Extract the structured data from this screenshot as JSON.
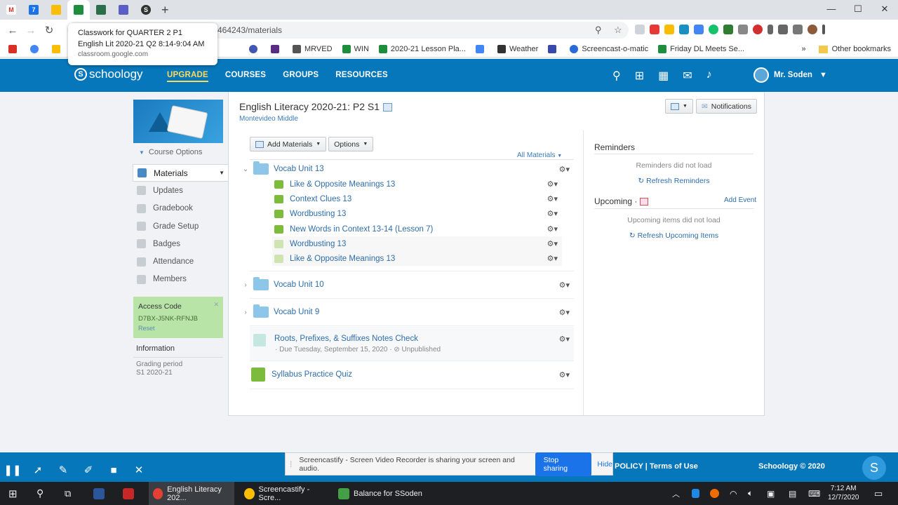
{
  "browser": {
    "tooltip": {
      "title": "Classwork for QUARTER 2 P1 English Lit 2020-21 Q2 8:14-9:04 AM",
      "url": "classroom.google.com"
    },
    "address_url": "464243/materials",
    "bookmarks": [
      {
        "label": "MRVED",
        "color": "#555555"
      },
      {
        "label": "WIN",
        "color": "#1e8e3e"
      },
      {
        "label": "2020-21 Lesson Pla...",
        "color": "#1e8e3e"
      },
      {
        "label": "Weather",
        "color": "#333333"
      },
      {
        "label": "Screencast-o-matic",
        "color": "#2a6ad6"
      },
      {
        "label": "Friday DL Meets Se...",
        "color": "#1e8e3e"
      }
    ],
    "other_bookmarks": "Other bookmarks",
    "more": "»"
  },
  "header": {
    "logo": "schoology",
    "nav": [
      "UPGRADE",
      "COURSES",
      "GROUPS",
      "RESOURCES"
    ],
    "user": "Mr. Soden"
  },
  "sidebar": {
    "course_options": "Course Options",
    "items": [
      {
        "label": "Materials"
      },
      {
        "label": "Updates"
      },
      {
        "label": "Gradebook"
      },
      {
        "label": "Grade Setup"
      },
      {
        "label": "Badges"
      },
      {
        "label": "Attendance"
      },
      {
        "label": "Members"
      }
    ],
    "access": {
      "title": "Access Code",
      "code": "D7BX-J5NK-RFNJB",
      "reset": "Reset"
    },
    "info_title": "Information",
    "grading_label": "Grading period",
    "grading_value": "S1 2020-21"
  },
  "course": {
    "title": "English Literacy 2020-21: P2 S1",
    "school": "Montevideo Middle",
    "notifications": "Notifications"
  },
  "materials": {
    "add": "Add Materials",
    "options": "Options",
    "filter": "All Materials",
    "folder1": "Vocab Unit 13",
    "children": [
      "Like & Opposite Meanings 13",
      "Context Clues 13",
      "Wordbusting 13",
      "New Words in Context 13-14 (Lesson 7)",
      "Wordbusting 13",
      "Like & Opposite Meanings 13"
    ],
    "folder2": "Vocab Unit 10",
    "folder3": "Vocab Unit 9",
    "assignment": {
      "title": "Roots, Prefixes, & Suffixes Notes Check",
      "due": "· Due Tuesday, September 15, 2020 · ⊘ Unpublished"
    },
    "quiz": "Syllabus Practice Quiz"
  },
  "right": {
    "reminders": "Reminders",
    "reminders_msg": "Reminders did not load",
    "refresh_reminders": "Refresh Reminders",
    "upcoming": "Upcoming ·",
    "add_event": "Add Event",
    "upcoming_msg": "Upcoming items did not load",
    "refresh_upcoming": "Refresh Upcoming Items"
  },
  "footer": {
    "policy": "POLICY   |   Terms of Use",
    "copyright": "Schoology © 2020",
    "badge": "S"
  },
  "share_bar": {
    "message": "Screencastify - Screen Video Recorder is sharing your screen and audio.",
    "stop": "Stop sharing",
    "hide": "Hide"
  },
  "taskbar": {
    "items": [
      "English Literacy 202...",
      "Screencastify - Scre...",
      "Balance for SSoden"
    ],
    "time": "7:12 AM",
    "date": "12/7/2020"
  }
}
